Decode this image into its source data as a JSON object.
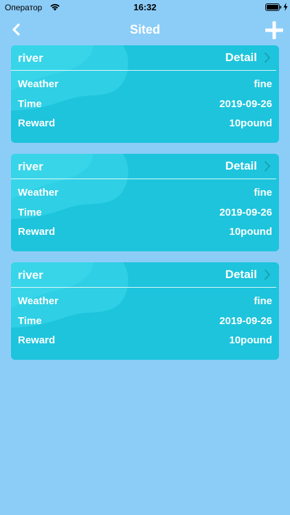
{
  "status_bar": {
    "carrier": "Оператор",
    "time": "16:32"
  },
  "nav": {
    "title": "Sited",
    "back_icon": "chevron-left-icon",
    "add_icon": "plus-icon"
  },
  "colors": {
    "background": "#8ccdf8",
    "card": "#1dc4dc",
    "text": "#ffffff"
  },
  "cards": [
    {
      "name": "river",
      "detail_label": "Detail",
      "rows": [
        {
          "label": "Weather",
          "value": "fine"
        },
        {
          "label": "Time",
          "value": "2019-09-26"
        },
        {
          "label": "Reward",
          "value": "10pound"
        }
      ]
    },
    {
      "name": "river",
      "detail_label": "Detail",
      "rows": [
        {
          "label": "Weather",
          "value": "fine"
        },
        {
          "label": "Time",
          "value": "2019-09-26"
        },
        {
          "label": "Reward",
          "value": "10pound"
        }
      ]
    },
    {
      "name": "river",
      "detail_label": "Detail",
      "rows": [
        {
          "label": "Weather",
          "value": "fine"
        },
        {
          "label": "Time",
          "value": "2019-09-26"
        },
        {
          "label": "Reward",
          "value": "10pound"
        }
      ]
    }
  ]
}
